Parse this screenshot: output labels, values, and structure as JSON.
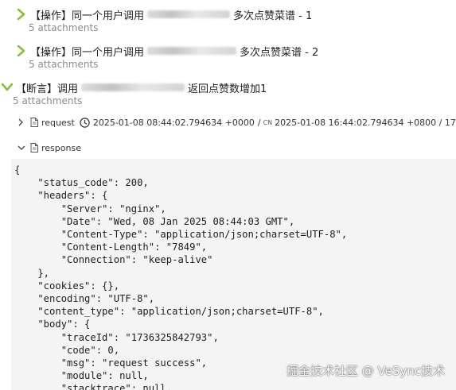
{
  "steps": [
    {
      "prefix": "【操作】同一个用户调用",
      "suffix": "多次点赞菜谱 - 1",
      "attachments": "5 attachments"
    },
    {
      "prefix": "【操作】同一个用户调用",
      "suffix": "多次点赞菜谱 - 2",
      "attachments": "5 attachments"
    },
    {
      "prefix": "【断言】调用",
      "suffix": "返回点赞数增加1",
      "attachments": "5 attachments"
    }
  ],
  "request": {
    "label": "request",
    "utc_time": "2025-01-08 08:44:02.794634 +0000",
    "separator": "/",
    "cn_label": "CN",
    "cn_time": "2025-01-08 16:44:02.794634 +0800 / 173"
  },
  "response": {
    "label": "response"
  },
  "code_lines": [
    "{",
    "    \"status_code\": 200,",
    "    \"headers\": {",
    "        \"Server\": \"nginx\",",
    "        \"Date\": \"Wed, 08 Jan 2025 08:44:03 GMT\",",
    "        \"Content-Type\": \"application/json;charset=UTF-8\",",
    "        \"Content-Length\": \"7849\",",
    "        \"Connection\": \"keep-alive\"",
    "    },",
    "    \"cookies\": {},",
    "    \"encoding\": \"UTF-8\",",
    "    \"content_type\": \"application/json;charset=UTF-8\",",
    "    \"body\": {",
    "        \"traceId\": \"1736325842793\",",
    "        \"code\": 0,",
    "        \"msg\": \"request success\",",
    "        \"module\": null,",
    "        \"stacktrace\": null,"
  ],
  "watermark": "掘金技术社区 @ VeSync技术",
  "colors": {
    "chevron_green": "#8bbf3a",
    "code_background": "#f4f4f4",
    "attachment_gray": "#8a8a8a"
  },
  "icons": [
    "chevron-right-icon",
    "chevron-down-icon",
    "document-icon",
    "clock-icon"
  ]
}
